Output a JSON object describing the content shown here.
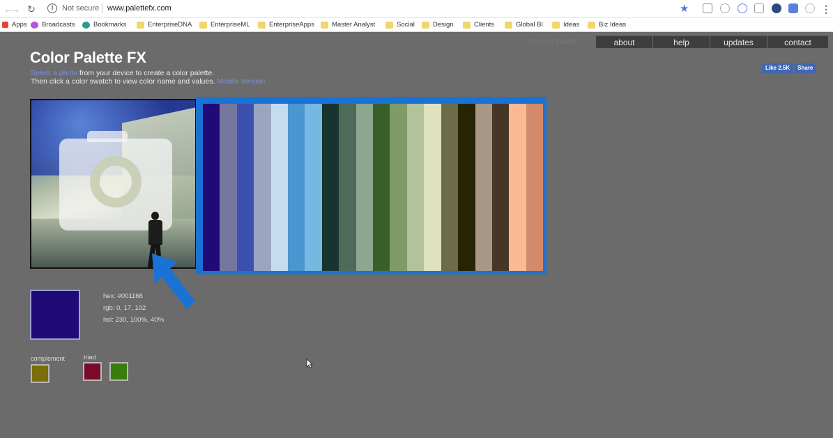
{
  "browser": {
    "secure_label": "Not secure",
    "url": "www.palettefx.com",
    "bookmarks": [
      {
        "label": "Apps",
        "kind": "apps",
        "color": "#e94235"
      },
      {
        "label": "Broadcasts",
        "kind": "podcast",
        "color": "#b05ad8"
      },
      {
        "label": "Bookmarks",
        "kind": "star",
        "color": "#2b9b8e"
      },
      {
        "label": "EnterpriseDNA",
        "kind": "folder",
        "color": "#f3d56b"
      },
      {
        "label": "EnterpriseML",
        "kind": "folder",
        "color": "#f3d56b"
      },
      {
        "label": "EnterpriseApps",
        "kind": "folder",
        "color": "#f3d56b"
      },
      {
        "label": "Master Analyst",
        "kind": "folder",
        "color": "#f3d56b"
      },
      {
        "label": "Social",
        "kind": "folder",
        "color": "#f3d56b"
      },
      {
        "label": "Design",
        "kind": "folder",
        "color": "#f3d56b"
      },
      {
        "label": "Clients",
        "kind": "folder",
        "color": "#f3d56b"
      },
      {
        "label": "Global BI",
        "kind": "folder",
        "color": "#f3d56b"
      },
      {
        "label": "Ideas",
        "kind": "folder",
        "color": "#f3d56b"
      },
      {
        "label": "Biz Ideas",
        "kind": "folder",
        "color": "#f3d56b"
      }
    ]
  },
  "site": {
    "title": "Color Palette FX",
    "nav": [
      "about",
      "help",
      "updates",
      "contact"
    ],
    "faded_nav_label": "Product Palette",
    "intro_line1_link": "Select a photo",
    "intro_line1_rest": " from your device to create a color palette.",
    "intro_line2_text": "Then click a color swatch to view color name and values.",
    "intro_line2_link": "Mobile Version",
    "fb_like": "Like 2.5K",
    "fb_share": "Share"
  },
  "palette": {
    "swatches": [
      "#1f0a78",
      "#76779e",
      "#3b50b0",
      "#9aa6c0",
      "#c4dcef",
      "#4a96d0",
      "#76b8e2",
      "#173431",
      "#4d6b5b",
      "#8da690",
      "#395f2a",
      "#7f9b67",
      "#b1c29c",
      "#dee3bd",
      "#6c6b4b",
      "#262503",
      "#a89784",
      "#473626",
      "#f9b993",
      "#d38a6b"
    ]
  },
  "selected": {
    "color": "#1f0a78",
    "hex_text": "hex: #001166",
    "rgb_text": "rgb: 0, 17, 102",
    "hsl_text": "hsl: 230, 100%, 40%",
    "complement_label": "complement",
    "complement_color": "#7c6d0a",
    "triad_label": "triad",
    "triad_colors": [
      "#7b0a28",
      "#397d0b"
    ]
  }
}
